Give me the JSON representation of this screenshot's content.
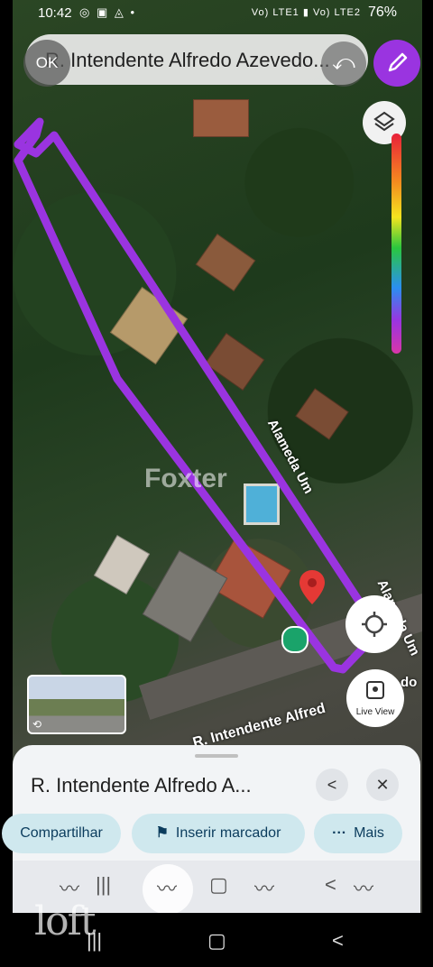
{
  "status_bar": {
    "time": "10:42",
    "left_icons": "◎ ▣ ◬ •",
    "signal": "Vo) LTE1 ▮ Vo) LTE2",
    "battery": "76%"
  },
  "search": {
    "ok_label": "OK",
    "query": "R. Intendente Alfredo Azevedo...",
    "undo_icon": "undo-icon",
    "edit_icon": "pencil-icon"
  },
  "map": {
    "street_main": "R. Intendente Alfred",
    "street_do": "do",
    "street_alameda1": "Alameda Um",
    "street_alameda2": "Alameda Um",
    "watermark": "Foxter",
    "live_view_label": "Live View"
  },
  "colors": {
    "drawing": "#9a34e0",
    "accent_chip": "#cfe8ee",
    "pin": "#e53935"
  },
  "sheet": {
    "title": "R. Intendente Alfredo A...",
    "actions": [
      {
        "label": "Compartilhar",
        "icon": "share-icon"
      },
      {
        "label": "Inserir marcador",
        "icon": "flag-icon"
      },
      {
        "label": "Mais",
        "icon": "more-icon"
      }
    ]
  },
  "watermark_brand": "loft"
}
